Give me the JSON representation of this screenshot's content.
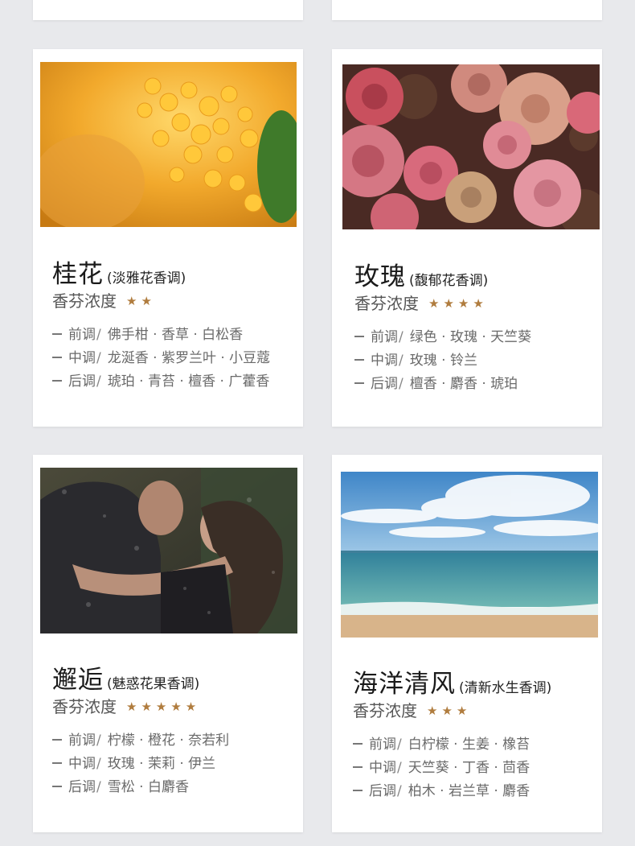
{
  "cards": [
    {
      "name": "桂花",
      "subtitle": "(淡雅花香调)",
      "intensity_label": "香芬浓度",
      "stars": "★★",
      "rating": 2,
      "notes": [
        {
          "label": "前调",
          "sep": "/",
          "value": "佛手柑 · 香草 · 白松香"
        },
        {
          "label": "中调",
          "sep": "/",
          "value": "龙涎香 · 紫罗兰叶 · 小豆蔻"
        },
        {
          "label": "后调",
          "sep": "/",
          "value": "琥珀 · 青苔 · 檀香 · 广藿香"
        }
      ],
      "photo_icon": "osmanthus-photo"
    },
    {
      "name": "玫瑰",
      "subtitle": "(馥郁花香调)",
      "intensity_label": "香芬浓度",
      "stars": "★★★★",
      "rating": 4,
      "notes": [
        {
          "label": "前调",
          "sep": "/",
          "value": "绿色 · 玫瑰 · 天竺葵"
        },
        {
          "label": "中调",
          "sep": "/",
          "value": "玫瑰 · 铃兰"
        },
        {
          "label": "后调",
          "sep": "/",
          "value": "檀香 · 麝香 · 琥珀"
        }
      ],
      "photo_icon": "rose-photo"
    },
    {
      "name": "邂逅",
      "subtitle": "(魅惑花果香调)",
      "intensity_label": "香芬浓度",
      "stars": "★★★★★",
      "rating": 5,
      "notes": [
        {
          "label": "前调",
          "sep": "/",
          "value": "柠檬 · 橙花 · 奈若利"
        },
        {
          "label": "中调",
          "sep": "/",
          "value": "玫瑰 · 茉莉 · 伊兰"
        },
        {
          "label": "后调",
          "sep": "/",
          "value": "雪松 · 白麝香"
        }
      ],
      "photo_icon": "couple-photo"
    },
    {
      "name": "海洋清风",
      "subtitle": "(清新水生香调)",
      "intensity_label": "香芬浓度",
      "stars": "★★★",
      "rating": 3,
      "notes": [
        {
          "label": "前调",
          "sep": "/",
          "value": "白柠檬 · 生姜 · 橡苔"
        },
        {
          "label": "中调",
          "sep": "/",
          "value": "天竺葵 · 丁香 · 茴香"
        },
        {
          "label": "后调",
          "sep": "/",
          "value": "柏木 · 岩兰草 · 麝香"
        }
      ],
      "photo_icon": "ocean-photo"
    }
  ],
  "colors": {
    "background": "#e8e9ec",
    "card": "#ffffff",
    "star": "#b07c3e"
  }
}
